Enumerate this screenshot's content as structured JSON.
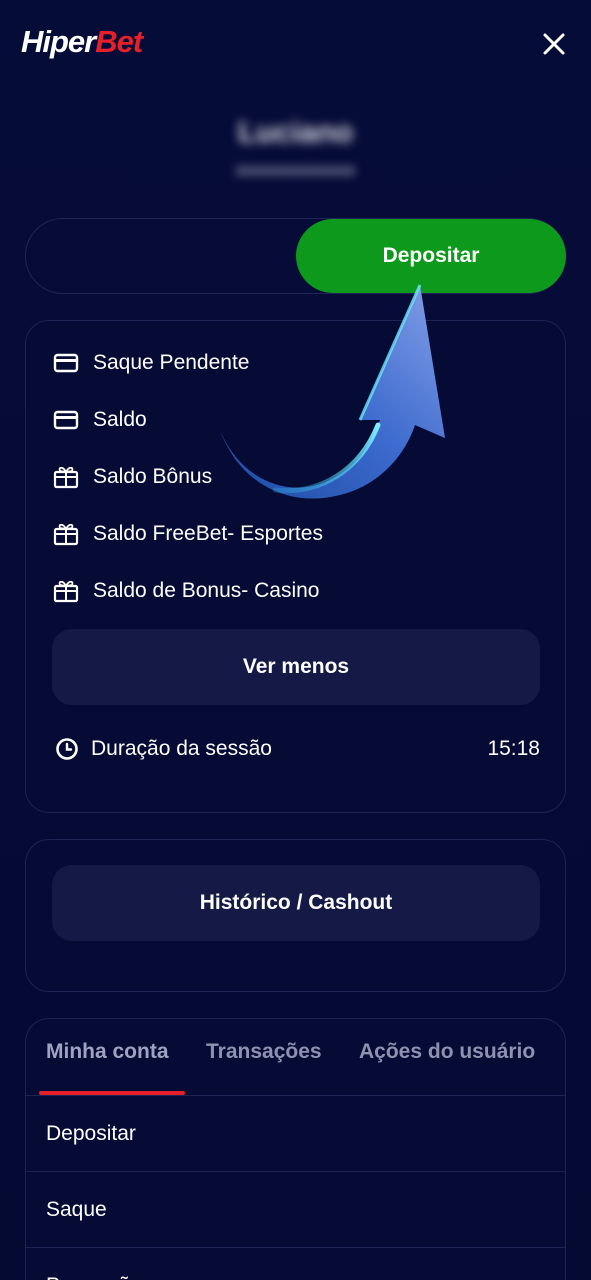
{
  "header": {
    "logo_part1": "Hiper",
    "logo_part2": "Bet",
    "close_icon": "close-icon"
  },
  "user": {
    "name": "Luciano",
    "id": "●●●●●●●●●●●"
  },
  "deposit_button": "Depositar",
  "balances": [
    {
      "label": "Saque Pendente",
      "icon": "card-icon"
    },
    {
      "label": "Saldo",
      "icon": "card-icon"
    },
    {
      "label": "Saldo Bônus",
      "icon": "gift-icon"
    },
    {
      "label": "Saldo FreeBet- Esportes",
      "icon": "gift-icon"
    },
    {
      "label": "Saldo de Bonus- Casino",
      "icon": "gift-icon"
    }
  ],
  "ver_menos": "Ver menos",
  "session": {
    "label": "Duração da sessão",
    "value": "15:18",
    "icon": "clock-icon"
  },
  "history_button": "Histórico / Cashout",
  "tabs": [
    {
      "label": "Minha conta",
      "active": true
    },
    {
      "label": "Transações",
      "active": false
    },
    {
      "label": "Ações do usuário",
      "active": false
    }
  ],
  "menu": [
    {
      "label": "Depositar"
    },
    {
      "label": "Saque"
    },
    {
      "label": "Promoções"
    }
  ],
  "colors": {
    "background": "#050b36",
    "accent_green": "#0d9a1c",
    "brand_red": "#e5202a",
    "card_border": "#1c2454",
    "soft_button": "#141a45"
  }
}
